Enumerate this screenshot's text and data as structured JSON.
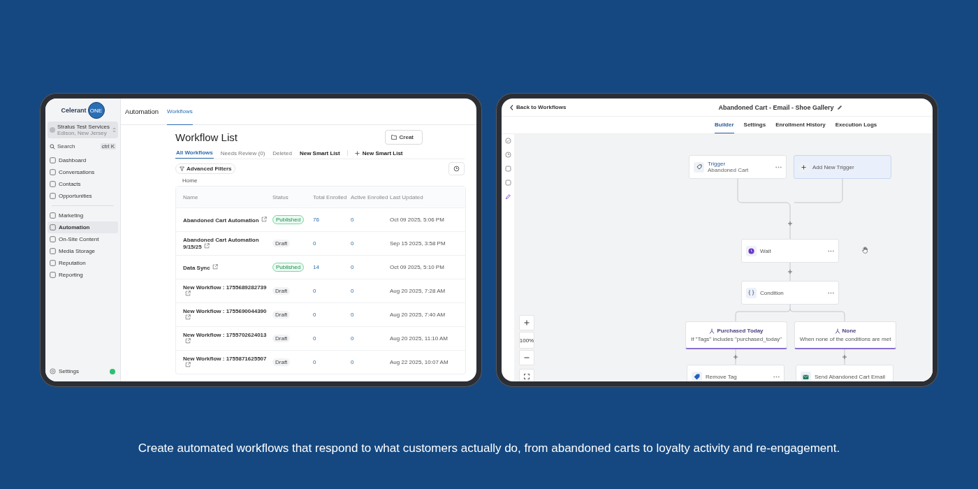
{
  "caption": "Create automated workflows that respond to what customers actually do, from abandoned carts to loyalty activity and re-engagement.",
  "list_screen": {
    "logo": {
      "name": "Celerant",
      "badge": "ONE"
    },
    "account": {
      "name": "Stratus Test Services",
      "location": "Edison, New Jersey"
    },
    "search": {
      "placeholder": "Search",
      "shortcut": "ctrl K"
    },
    "nav_groups": [
      [
        {
          "label": "Dashboard",
          "selected": false
        },
        {
          "label": "Conversations",
          "selected": false
        },
        {
          "label": "Contacts",
          "selected": false
        },
        {
          "label": "Opportunities",
          "selected": false
        }
      ],
      [
        {
          "label": "Marketing",
          "selected": false
        },
        {
          "label": "Automation",
          "selected": true
        },
        {
          "label": "On-Site Content",
          "selected": false
        },
        {
          "label": "Media Storage",
          "selected": false
        },
        {
          "label": "Reputation",
          "selected": false
        },
        {
          "label": "Reporting",
          "selected": false
        }
      ]
    ],
    "settings": "Settings",
    "header": {
      "title": "Automation",
      "tabs": [
        {
          "label": "Workflows",
          "selected": true
        }
      ]
    },
    "page_title": "Workflow List",
    "create_button": "Creat",
    "list_tabs": [
      {
        "label": "All Workflows",
        "selected": true
      },
      {
        "label": "Needs Review (0)",
        "selected": false
      },
      {
        "label": "Deleted",
        "selected": false
      },
      {
        "label": "New Smart List",
        "selected": false
      }
    ],
    "add_smart_list": "New Smart List",
    "filters_button": "Advanced Filters",
    "breadcrumb": "Home",
    "table": {
      "columns": [
        "Name",
        "Status",
        "Total Enrolled",
        "Active Enrolled",
        "Last Updated"
      ],
      "rows": [
        {
          "name": "Abandoned Cart Automation",
          "status": "Published",
          "published": true,
          "total": "76",
          "active": "0",
          "updated": "Oct 09 2025, 5:06 PM"
        },
        {
          "name": "Abandoned Cart Automation 9/15/25",
          "status": "Draft",
          "published": false,
          "total": "0",
          "active": "0",
          "updated": "Sep 15 2025, 3:58 PM"
        },
        {
          "name": "Data Sync",
          "status": "Published",
          "published": true,
          "total": "14",
          "active": "0",
          "updated": "Oct 09 2025, 5:10 PM"
        },
        {
          "name": "New Workflow : 1755689282739",
          "status": "Draft",
          "published": false,
          "total": "0",
          "active": "0",
          "updated": "Aug 20 2025, 7:28 AM"
        },
        {
          "name": "New Workflow : 1755690044390",
          "status": "Draft",
          "published": false,
          "total": "0",
          "active": "0",
          "updated": "Aug 20 2025, 7:40 AM"
        },
        {
          "name": "New Workflow : 1755702624013",
          "status": "Draft",
          "published": false,
          "total": "0",
          "active": "0",
          "updated": "Aug 20 2025, 11:10 AM"
        },
        {
          "name": "New Workflow : 1755871625507",
          "status": "Draft",
          "published": false,
          "total": "0",
          "active": "0",
          "updated": "Aug 22 2025, 10:07 AM"
        }
      ]
    }
  },
  "builder_screen": {
    "back_link": "Back to Workflows",
    "title": "Abandoned Cart - Email - Shoe Gallery",
    "tabs": [
      {
        "label": "Builder",
        "selected": true
      },
      {
        "label": "Settings",
        "selected": false
      },
      {
        "label": "Enrollment History",
        "selected": false
      },
      {
        "label": "Execution Logs",
        "selected": false
      }
    ],
    "side_tools": [
      {
        "selected": false
      },
      {
        "selected": false
      },
      {
        "selected": false
      },
      {
        "selected": false
      },
      {
        "selected": true
      }
    ],
    "trigger": {
      "title": "Trigger",
      "subtitle": "Abandoned Cart"
    },
    "add_trigger": "Add New Trigger",
    "steps": [
      {
        "kind": "wait",
        "label": "Wait"
      },
      {
        "kind": "condition",
        "label": "Condition"
      }
    ],
    "branches": [
      {
        "title": "Purchased Today",
        "description": "If \"Tags\" includes \"purchased_today\""
      },
      {
        "title": "None",
        "description": "When none of the conditions are met"
      }
    ],
    "actions": [
      {
        "kind": "tag",
        "label": "Remove Tag"
      },
      {
        "kind": "email",
        "label": "Send Abandoned Cart Email"
      }
    ],
    "zoom_level": "100%"
  }
}
